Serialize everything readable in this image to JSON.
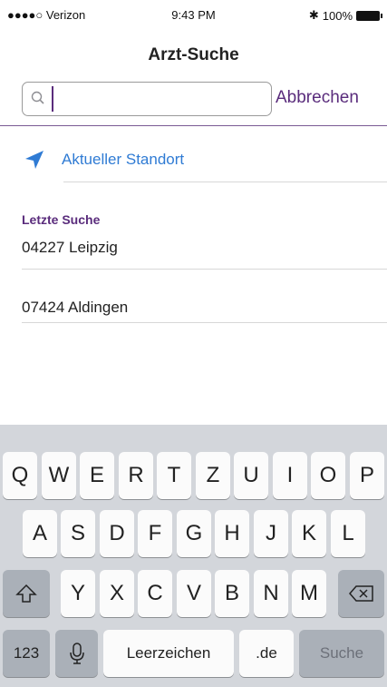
{
  "status_bar": {
    "carrier": "●●●●○ Verizon",
    "time": "9:43 PM",
    "battery": "100%"
  },
  "header": {
    "title": "Arzt-Suche"
  },
  "search": {
    "placeholder": "",
    "value": "",
    "cancel_label": "Abbrechen"
  },
  "location": {
    "label": "Aktueller Standort",
    "icon": "location-arrow-icon",
    "color": "#2f7bd4"
  },
  "recent": {
    "header": "Letzte Suche",
    "items": [
      {
        "label": "04227 Leipzig"
      },
      {
        "label": "07424 Aldingen"
      }
    ]
  },
  "keyboard": {
    "row1": [
      "Q",
      "W",
      "E",
      "R",
      "T",
      "Z",
      "U",
      "I",
      "O",
      "P"
    ],
    "row2": [
      "A",
      "S",
      "D",
      "F",
      "G",
      "H",
      "J",
      "K",
      "L"
    ],
    "row3": [
      "Y",
      "X",
      "C",
      "V",
      "B",
      "N",
      "M"
    ],
    "numbers_label": "123",
    "space_label": "Leerzeichen",
    "domain_label": ".de",
    "return_label": "Suche"
  },
  "colors": {
    "accent": "#5a2c7c",
    "link": "#2f7bd4",
    "keyboard_bg": "#d3d6db"
  }
}
